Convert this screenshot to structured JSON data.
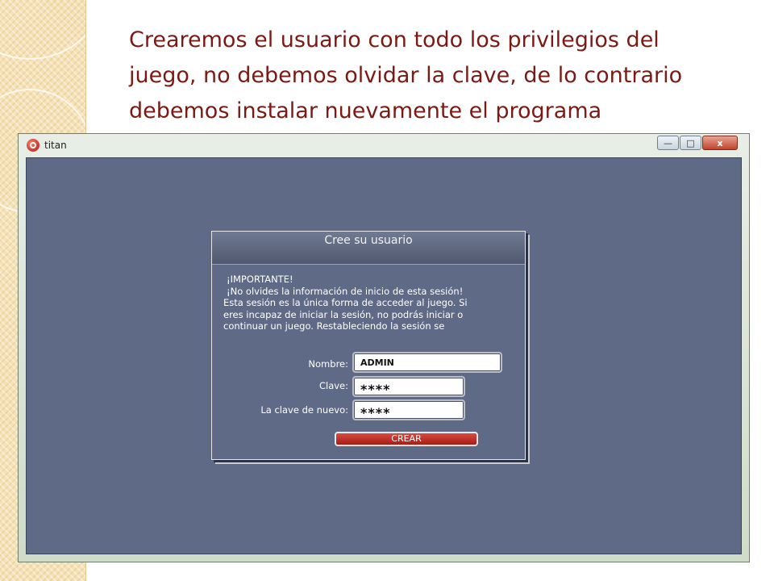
{
  "slide": {
    "title_lines": [
      "Crearemos el usuario con todo los privilegios del",
      "juego, no debemos olvidar la clave, de lo contrario",
      "debemos instalar nuevamente el programa"
    ]
  },
  "window": {
    "title": "titan",
    "controls": {
      "minimize": "—",
      "maximize": "□",
      "close": "x"
    }
  },
  "dialog": {
    "title": "Cree su usuario",
    "message_lines": [
      "¡IMPORTANTE!",
      "¡No olvides la información de inicio de esta sesión!",
      "Esta sesión es la única forma de acceder al juego. Si",
      "eres incapaz de iniciar la sesión, no podrás iniciar o",
      "continuar un juego. Restableciendo la sesión se"
    ],
    "nombre_label": "Nombre:",
    "nombre_value": "ADMIN",
    "clave_label": "Clave:",
    "clave_value": "****",
    "clave2_label": "La clave de nuevo:",
    "clave2_value": "****",
    "crear_label": "CREAR"
  },
  "colors": {
    "title_text": "#7b1a14",
    "client_bg": "#5f6a87",
    "crear_button": "#c0322a"
  }
}
